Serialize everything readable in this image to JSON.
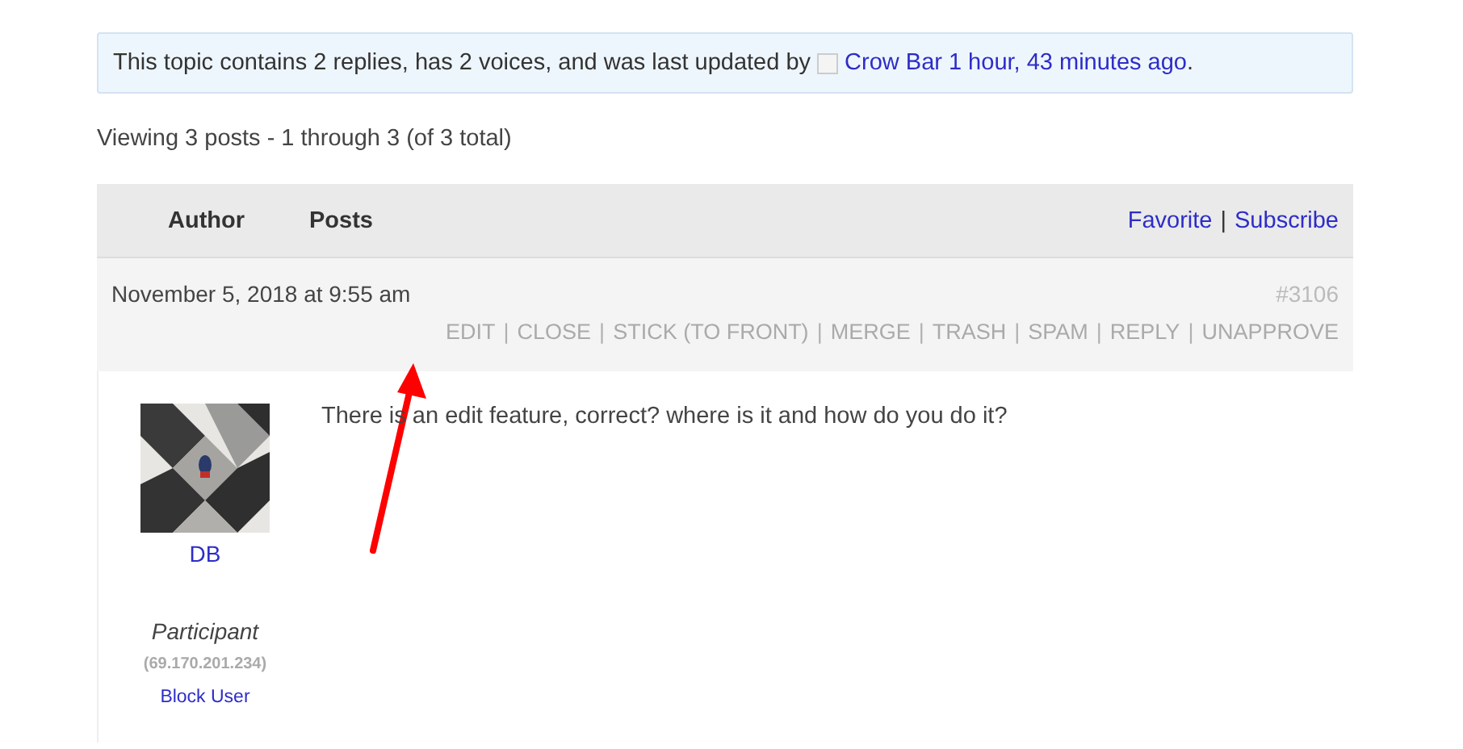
{
  "notice": {
    "text": "This topic contains 2 replies, has 2 voices, and was last updated by",
    "author": "Crow Bar",
    "time": "1 hour, 43 minutes ago",
    "end": "."
  },
  "viewing": "Viewing 3 posts - 1 through 3 (of 3 total)",
  "header": {
    "columns": [
      "Author",
      "Posts"
    ],
    "links": [
      "Favorite",
      "Subscribe"
    ],
    "separator": "|"
  },
  "post": {
    "date": "November 5, 2018 at 9:55 am",
    "number": "#3106",
    "actions": [
      "EDIT",
      "CLOSE",
      "STICK (TO FRONT)",
      "MERGE",
      "TRASH",
      "SPAM",
      "REPLY",
      "UNAPPROVE"
    ],
    "author": {
      "name": "DB",
      "role": "Participant",
      "ip": "(69.170.201.234)",
      "block": "Block User"
    },
    "content": "There is an edit feature, correct? where is it and how do you do it?"
  }
}
